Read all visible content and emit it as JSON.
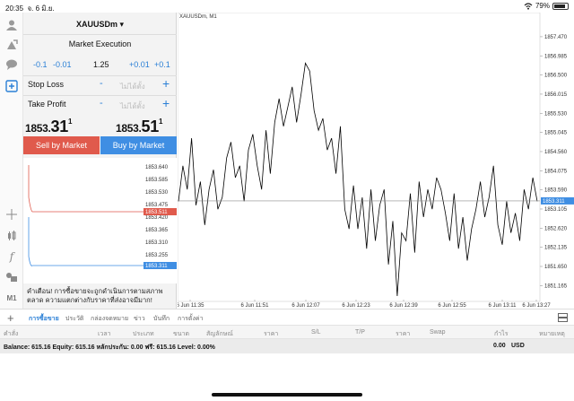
{
  "status_bar": {
    "time": "20:35",
    "date": "จ. 6 มิ.ย.",
    "wifi_icon": "wifi-icon",
    "battery_percent": "79%",
    "battery_level": 0.79
  },
  "toolbar": {
    "icons": [
      "user-icon",
      "trade-icon",
      "chat-icon",
      "new-order-icon"
    ],
    "bottom_icons": [
      "crosshair-icon",
      "candles-icon",
      "function-icon",
      "objects-icon"
    ],
    "timeframe": "M1"
  },
  "order": {
    "symbol": "XAUUSDm ▾",
    "execution": "Market Execution",
    "vol_steps": [
      "-0.1",
      "-0.01",
      "1.25",
      "+0.01",
      "+0.1"
    ],
    "stop_loss_label": "Stop Loss",
    "take_profit_label": "Take Profit",
    "not_set": "ไม่ได้ตั้ง",
    "minus": "-",
    "plus": "+",
    "bid_prefix": "1853.",
    "bid_big": "31",
    "bid_sup": "1",
    "ask_prefix": "1853.",
    "ask_big": "51",
    "ask_sup": "1",
    "sell_label": "Sell by Market",
    "buy_label": "Buy by Market",
    "warning": "คำเตือน! การซื้อขายจะถูกดำเนินการตามสภาพตลาด ความแตกต่างกับราคาที่ส่งอาจมีมาก!",
    "mini_ticks": [
      "1853.640",
      "1853.585",
      "1853.530",
      "1853.475",
      "1853.420",
      "1853.365",
      "1853.310",
      "1853.255"
    ],
    "mini_ask": "1853.511",
    "mini_bid": "1853.311"
  },
  "chart": {
    "title": "XAUUSDm, M1",
    "y_ticks": [
      "1857.470",
      "1856.985",
      "1856.500",
      "1856.015",
      "1855.530",
      "1855.045",
      "1854.560",
      "1854.075",
      "1853.590",
      "1853.105",
      "1852.620",
      "1852.135",
      "1851.650",
      "1851.165"
    ],
    "current_price": "1853.311",
    "x_ticks": [
      "6 Jun 11:35",
      "6 Jun 11:51",
      "6 Jun 12:07",
      "6 Jun 12:23",
      "6 Jun 12:39",
      "6 Jun 12:55",
      "6 Jun 13:11",
      "6 Jun 13:27"
    ],
    "colors": {
      "line": "#000000",
      "bid_line": "#8c8c8c",
      "bid_badge": "#3f8ee3",
      "ask_badge": "#e05a4c"
    }
  },
  "chart_data": {
    "type": "line",
    "title": "XAUUSDm, M1",
    "ylim": [
      1850.9,
      1857.9
    ],
    "y": [
      1853.3,
      1854.2,
      1853.6,
      1854.9,
      1853.2,
      1853.8,
      1852.7,
      1853.6,
      1854.1,
      1853.1,
      1853.4,
      1854.4,
      1854.8,
      1853.9,
      1854.2,
      1853.3,
      1854.6,
      1855.0,
      1854.2,
      1853.6,
      1855.1,
      1854.0,
      1855.3,
      1855.9,
      1855.2,
      1855.7,
      1856.2,
      1855.3,
      1856.0,
      1856.8,
      1856.6,
      1855.6,
      1855.1,
      1855.4,
      1854.6,
      1854.9,
      1854.0,
      1855.2,
      1853.1,
      1852.6,
      1853.7,
      1852.6,
      1853.4,
      1852.1,
      1853.6,
      1852.3,
      1853.2,
      1853.6,
      1851.7,
      1852.8,
      1850.9,
      1852.5,
      1852.3,
      1853.5,
      1852.0,
      1853.8,
      1852.9,
      1853.6,
      1853.1,
      1853.9,
      1853.6,
      1853.0,
      1852.3,
      1853.5,
      1852.1,
      1852.9,
      1851.8,
      1852.6,
      1853.1,
      1853.8,
      1852.9,
      1853.4,
      1854.2,
      1852.7,
      1852.2,
      1853.3,
      1852.5,
      1853.0,
      1852.3,
      1853.6,
      1853.1,
      1853.9,
      1853.3
    ]
  },
  "tabs": {
    "add": "+",
    "items": [
      "การซื้อขาย",
      "ประวัติ",
      "กล่องจดหมาย",
      "ข่าว",
      "บันทึก",
      "การตั้งค่า"
    ],
    "active": 0
  },
  "columns": {
    "items": [
      "คำสั่ง",
      "เวลา",
      "ประเภท",
      "ขนาด",
      "สัญลักษณ์",
      "ราคา",
      "S/L",
      "T/P",
      "ราคา",
      "Swap",
      "กำไร",
      "หมายเหตุ"
    ]
  },
  "balance": {
    "text": "Balance: 615.16 Equity: 615.16 หลักประกัน: 0.00 ฟรี: 615.16 Level: 0.00%",
    "profit": "0.00",
    "currency": "USD"
  }
}
